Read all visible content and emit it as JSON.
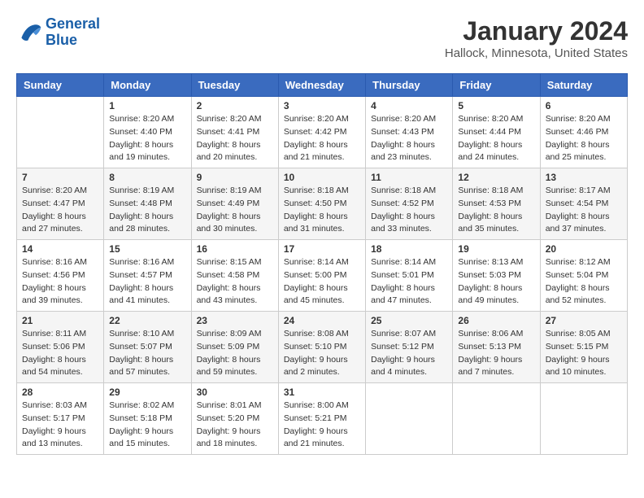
{
  "header": {
    "logo_line1": "General",
    "logo_line2": "Blue",
    "month": "January 2024",
    "location": "Hallock, Minnesota, United States"
  },
  "weekdays": [
    "Sunday",
    "Monday",
    "Tuesday",
    "Wednesday",
    "Thursday",
    "Friday",
    "Saturday"
  ],
  "weeks": [
    [
      {
        "day": "",
        "info": ""
      },
      {
        "day": "1",
        "info": "Sunrise: 8:20 AM\nSunset: 4:40 PM\nDaylight: 8 hours\nand 19 minutes."
      },
      {
        "day": "2",
        "info": "Sunrise: 8:20 AM\nSunset: 4:41 PM\nDaylight: 8 hours\nand 20 minutes."
      },
      {
        "day": "3",
        "info": "Sunrise: 8:20 AM\nSunset: 4:42 PM\nDaylight: 8 hours\nand 21 minutes."
      },
      {
        "day": "4",
        "info": "Sunrise: 8:20 AM\nSunset: 4:43 PM\nDaylight: 8 hours\nand 23 minutes."
      },
      {
        "day": "5",
        "info": "Sunrise: 8:20 AM\nSunset: 4:44 PM\nDaylight: 8 hours\nand 24 minutes."
      },
      {
        "day": "6",
        "info": "Sunrise: 8:20 AM\nSunset: 4:46 PM\nDaylight: 8 hours\nand 25 minutes."
      }
    ],
    [
      {
        "day": "7",
        "info": "Sunrise: 8:20 AM\nSunset: 4:47 PM\nDaylight: 8 hours\nand 27 minutes."
      },
      {
        "day": "8",
        "info": "Sunrise: 8:19 AM\nSunset: 4:48 PM\nDaylight: 8 hours\nand 28 minutes."
      },
      {
        "day": "9",
        "info": "Sunrise: 8:19 AM\nSunset: 4:49 PM\nDaylight: 8 hours\nand 30 minutes."
      },
      {
        "day": "10",
        "info": "Sunrise: 8:18 AM\nSunset: 4:50 PM\nDaylight: 8 hours\nand 31 minutes."
      },
      {
        "day": "11",
        "info": "Sunrise: 8:18 AM\nSunset: 4:52 PM\nDaylight: 8 hours\nand 33 minutes."
      },
      {
        "day": "12",
        "info": "Sunrise: 8:18 AM\nSunset: 4:53 PM\nDaylight: 8 hours\nand 35 minutes."
      },
      {
        "day": "13",
        "info": "Sunrise: 8:17 AM\nSunset: 4:54 PM\nDaylight: 8 hours\nand 37 minutes."
      }
    ],
    [
      {
        "day": "14",
        "info": "Sunrise: 8:16 AM\nSunset: 4:56 PM\nDaylight: 8 hours\nand 39 minutes."
      },
      {
        "day": "15",
        "info": "Sunrise: 8:16 AM\nSunset: 4:57 PM\nDaylight: 8 hours\nand 41 minutes."
      },
      {
        "day": "16",
        "info": "Sunrise: 8:15 AM\nSunset: 4:58 PM\nDaylight: 8 hours\nand 43 minutes."
      },
      {
        "day": "17",
        "info": "Sunrise: 8:14 AM\nSunset: 5:00 PM\nDaylight: 8 hours\nand 45 minutes."
      },
      {
        "day": "18",
        "info": "Sunrise: 8:14 AM\nSunset: 5:01 PM\nDaylight: 8 hours\nand 47 minutes."
      },
      {
        "day": "19",
        "info": "Sunrise: 8:13 AM\nSunset: 5:03 PM\nDaylight: 8 hours\nand 49 minutes."
      },
      {
        "day": "20",
        "info": "Sunrise: 8:12 AM\nSunset: 5:04 PM\nDaylight: 8 hours\nand 52 minutes."
      }
    ],
    [
      {
        "day": "21",
        "info": "Sunrise: 8:11 AM\nSunset: 5:06 PM\nDaylight: 8 hours\nand 54 minutes."
      },
      {
        "day": "22",
        "info": "Sunrise: 8:10 AM\nSunset: 5:07 PM\nDaylight: 8 hours\nand 57 minutes."
      },
      {
        "day": "23",
        "info": "Sunrise: 8:09 AM\nSunset: 5:09 PM\nDaylight: 8 hours\nand 59 minutes."
      },
      {
        "day": "24",
        "info": "Sunrise: 8:08 AM\nSunset: 5:10 PM\nDaylight: 9 hours\nand 2 minutes."
      },
      {
        "day": "25",
        "info": "Sunrise: 8:07 AM\nSunset: 5:12 PM\nDaylight: 9 hours\nand 4 minutes."
      },
      {
        "day": "26",
        "info": "Sunrise: 8:06 AM\nSunset: 5:13 PM\nDaylight: 9 hours\nand 7 minutes."
      },
      {
        "day": "27",
        "info": "Sunrise: 8:05 AM\nSunset: 5:15 PM\nDaylight: 9 hours\nand 10 minutes."
      }
    ],
    [
      {
        "day": "28",
        "info": "Sunrise: 8:03 AM\nSunset: 5:17 PM\nDaylight: 9 hours\nand 13 minutes."
      },
      {
        "day": "29",
        "info": "Sunrise: 8:02 AM\nSunset: 5:18 PM\nDaylight: 9 hours\nand 15 minutes."
      },
      {
        "day": "30",
        "info": "Sunrise: 8:01 AM\nSunset: 5:20 PM\nDaylight: 9 hours\nand 18 minutes."
      },
      {
        "day": "31",
        "info": "Sunrise: 8:00 AM\nSunset: 5:21 PM\nDaylight: 9 hours\nand 21 minutes."
      },
      {
        "day": "",
        "info": ""
      },
      {
        "day": "",
        "info": ""
      },
      {
        "day": "",
        "info": ""
      }
    ]
  ]
}
